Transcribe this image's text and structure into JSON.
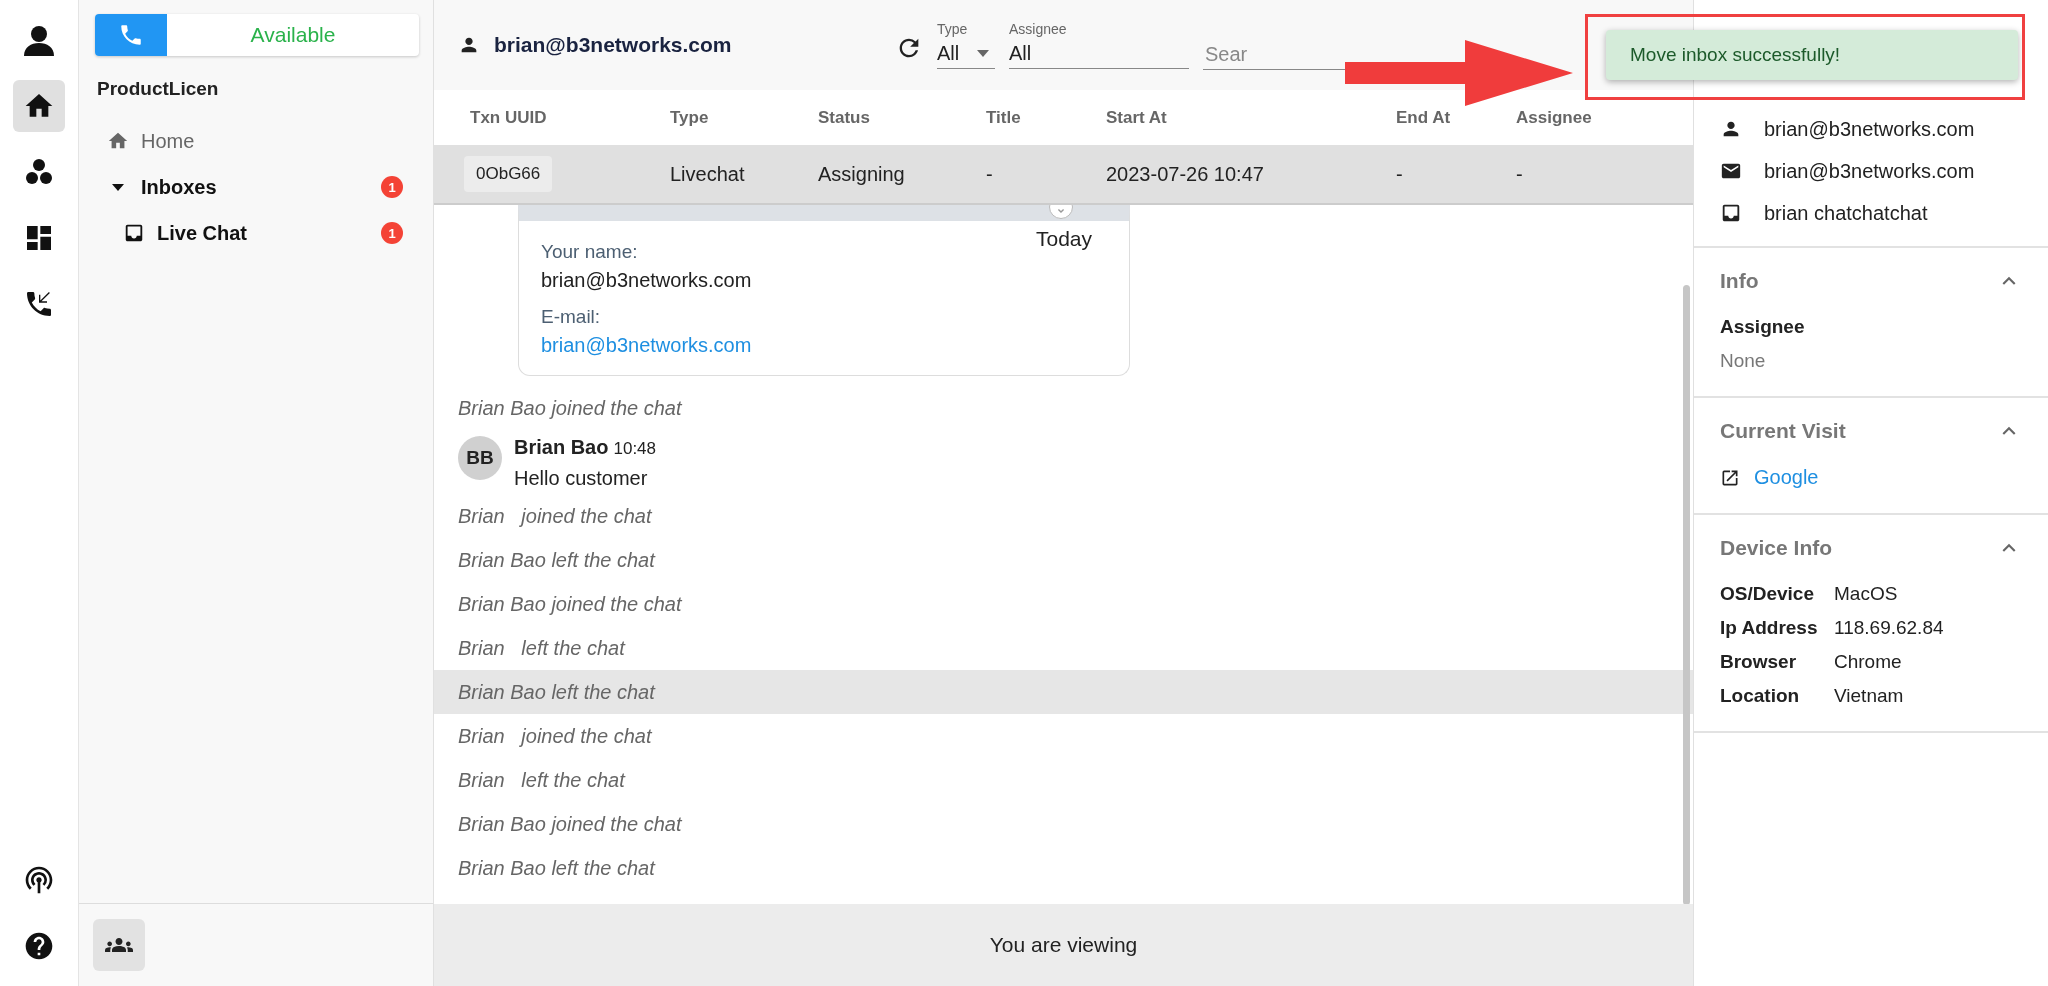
{
  "status_button": {
    "label": "Available",
    "on": true
  },
  "sidebar": {
    "title": "ProductLicen",
    "items": [
      {
        "label": "Home",
        "kind": "link"
      },
      {
        "label": "Inboxes",
        "kind": "group",
        "expanded": true,
        "badge": "1",
        "children": [
          {
            "label": "Live Chat",
            "kind": "inbox",
            "badge": "1"
          }
        ]
      }
    ]
  },
  "header": {
    "user": "brian@b3networks.com",
    "filters": [
      {
        "label": "Type",
        "value": "All",
        "kind": "select"
      },
      {
        "label": "Assignee",
        "value": "All",
        "kind": "text"
      }
    ],
    "search": {
      "placeholder": "Sear"
    }
  },
  "table": {
    "columns": [
      "Txn UUID",
      "Type",
      "Status",
      "Title",
      "Start At",
      "End At",
      "Assignee"
    ],
    "rows": [
      {
        "cells": [
          "0ObG66",
          "Livechat",
          "Assigning",
          "-",
          "2023-07-26 10:47",
          "-",
          "-"
        ],
        "selected": true
      }
    ]
  },
  "chat": {
    "date": "Today",
    "form": [
      {
        "label": "Your name:",
        "value": "brian@b3networks.com",
        "kind": "text"
      },
      {
        "label": "E-mail:",
        "value": "brian@b3networks.com",
        "kind": "link"
      }
    ],
    "events": [
      {
        "kind": "event",
        "text": "Brian Bao joined the chat",
        "hovered": false
      },
      {
        "kind": "message",
        "initials": "BB",
        "author": "Brian Bao",
        "time": "10:48",
        "text": "Hello customer"
      },
      {
        "kind": "event",
        "text": "Brian   joined the chat",
        "hovered": false
      },
      {
        "kind": "event",
        "text": "Brian Bao left the chat",
        "hovered": false
      },
      {
        "kind": "event",
        "text": "Brian Bao joined the chat",
        "hovered": false
      },
      {
        "kind": "event",
        "text": "Brian   left the chat",
        "hovered": false
      },
      {
        "kind": "event",
        "text": "Brian Bao left the chat",
        "hovered": true
      },
      {
        "kind": "event",
        "text": "Brian   joined the chat",
        "hovered": false
      },
      {
        "kind": "event",
        "text": "Brian   left the chat",
        "hovered": false
      },
      {
        "kind": "event",
        "text": "Brian Bao joined the chat",
        "hovered": false
      },
      {
        "kind": "event",
        "text": "Brian Bao left the chat",
        "hovered": false
      }
    ],
    "footer": "You are viewing"
  },
  "contact": [
    {
      "kind": "person",
      "text": "brian@b3networks.com"
    },
    {
      "kind": "mail",
      "text": "brian@b3networks.com"
    },
    {
      "kind": "inbox",
      "text": "brian chatchatchat"
    }
  ],
  "sections": [
    {
      "title": "Info",
      "expanded": true,
      "kind": "stack",
      "rows": [
        {
          "label": "Assignee",
          "value": "None"
        }
      ]
    },
    {
      "title": "Current Visit",
      "expanded": true,
      "kind": "link",
      "rows": [
        {
          "value": "Google"
        }
      ]
    },
    {
      "title": "Device Info",
      "expanded": true,
      "kind": "grid",
      "rows": [
        {
          "label": "OS/Device",
          "value": "MacOS"
        },
        {
          "label": "Ip Address",
          "value": "118.69.62.84"
        },
        {
          "label": "Browser",
          "value": "Chrome"
        },
        {
          "label": "Location",
          "value": "Vietnam"
        }
      ]
    }
  ],
  "toast": {
    "message": "Move inbox successfully!"
  }
}
